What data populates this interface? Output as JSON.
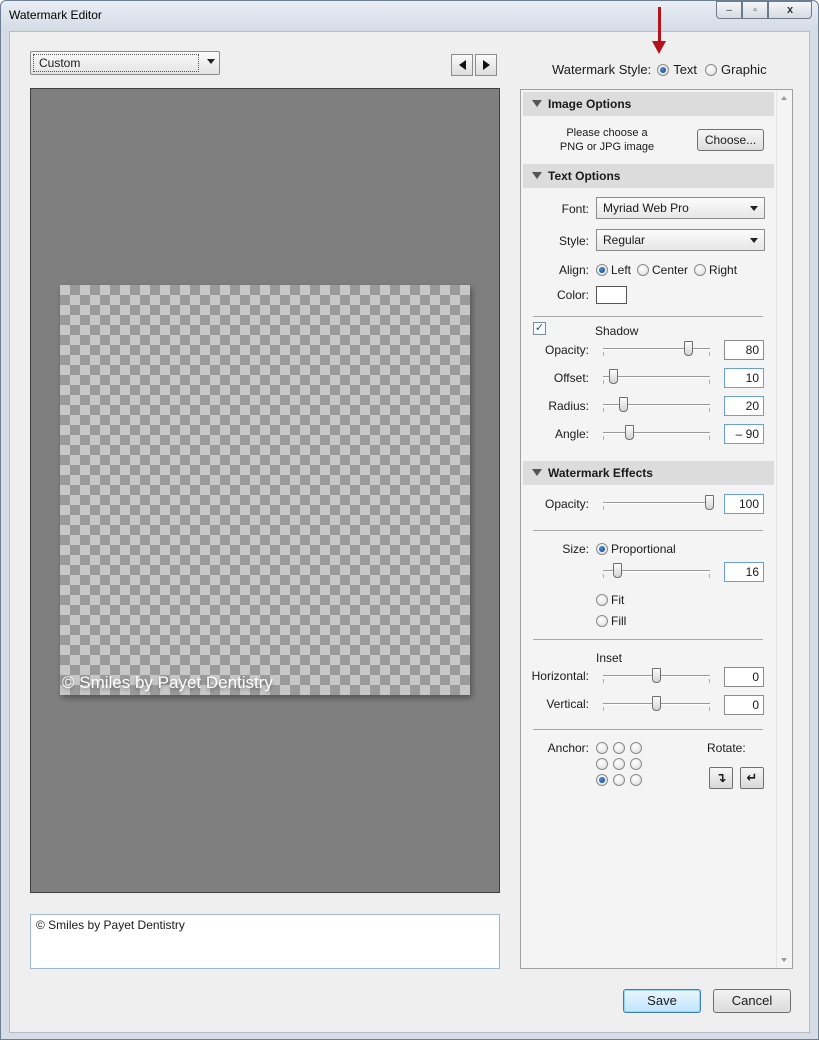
{
  "window": {
    "title": "Watermark Editor"
  },
  "window_controls": {
    "minimize": "–",
    "maximize": "▫",
    "close": "x"
  },
  "preset": {
    "value": "Custom"
  },
  "watermark_style": {
    "label": "Watermark Style:",
    "options": [
      "Text",
      "Graphic"
    ],
    "selected": "Text"
  },
  "preview": {
    "watermark_text": "© Smiles by Payet Dentistry"
  },
  "text_entry": {
    "value": "© Smiles by Payet Dentistry"
  },
  "image_options": {
    "header": "Image Options",
    "prompt_line1": "Please choose a",
    "prompt_line2": "PNG or JPG image",
    "choose_button": "Choose..."
  },
  "text_options": {
    "header": "Text Options",
    "font_label": "Font:",
    "font_value": "Myriad Web Pro",
    "style_label": "Style:",
    "style_value": "Regular",
    "align_label": "Align:",
    "align_options": [
      "Left",
      "Center",
      "Right"
    ],
    "align_selected": "Left",
    "color_label": "Color:",
    "color_value": "#ffffff",
    "shadow": {
      "label": "Shadow",
      "enabled": true,
      "opacity_label": "Opacity:",
      "opacity_value": "80",
      "opacity_fraction": 0.8,
      "offset_label": "Offset:",
      "offset_value": "10",
      "offset_fraction": 0.1,
      "radius_label": "Radius:",
      "radius_value": "20",
      "radius_fraction": 0.2,
      "angle_label": "Angle:",
      "angle_value": "– 90",
      "angle_fraction": 0.25
    }
  },
  "watermark_effects": {
    "header": "Watermark Effects",
    "opacity_label": "Opacity:",
    "opacity_value": "100",
    "opacity_fraction": 1.0,
    "size_label": "Size:",
    "size_options": [
      "Proportional",
      "Fit",
      "Fill"
    ],
    "size_selected": "Proportional",
    "size_value": "16",
    "size_fraction": 0.14,
    "inset_label": "Inset",
    "horizontal_label": "Horizontal:",
    "horizontal_value": "0",
    "horizontal_fraction": 0.5,
    "vertical_label": "Vertical:",
    "vertical_value": "0",
    "vertical_fraction": 0.5,
    "anchor_label": "Anchor:",
    "anchor_selected": "bottom-left",
    "rotate_label": "Rotate:"
  },
  "footer": {
    "save_label": "Save",
    "cancel_label": "Cancel"
  },
  "icons": {
    "prev": "triangle-left-icon",
    "next": "triangle-right-icon",
    "rotate_cw": "rotate-clockwise-icon",
    "rotate_ccw": "rotate-counterclockwise-icon",
    "rotate_cw_glyph": "↴",
    "rotate_ccw_glyph": "↵"
  },
  "colors": {
    "accent_arrow": "#b3141b",
    "preview_bg": "#7f7f7f"
  }
}
